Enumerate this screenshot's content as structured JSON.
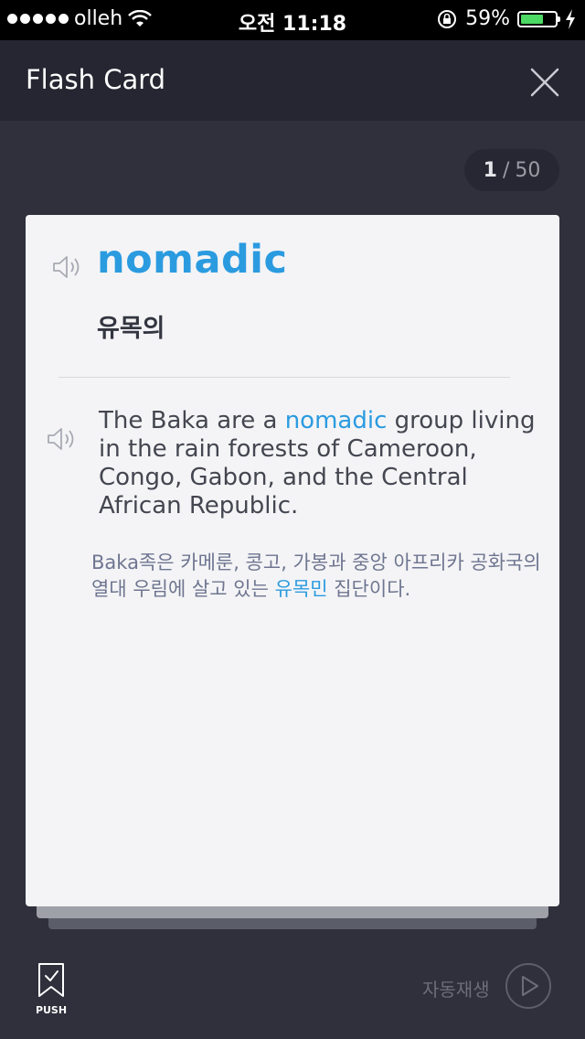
{
  "status_bar": {
    "carrier": "olleh",
    "time": "오전 11:18",
    "battery_percent": "59%",
    "battery_level": 0.59,
    "icons": [
      "signal-dots",
      "wifi-icon",
      "rotation-lock-icon",
      "battery-icon",
      "charging-bolt-icon"
    ]
  },
  "header": {
    "title": "Flash Card",
    "close_icon": "close-icon"
  },
  "counter": {
    "current": "1",
    "separator": "/",
    "total": "50"
  },
  "card": {
    "word": "nomadic",
    "meaning": "유목의",
    "example": {
      "before": "The Baka are a ",
      "highlight": "nomadic",
      "after": " group living in the rain forests of Cameroon, Congo, Gabon, and the Central African Republic."
    },
    "translation": {
      "before": "Baka족은 카메룬, 콩고, 가봉과 중앙 아프리카 공화국의 열대 우림에 살고 있는 ",
      "highlight": "유목민",
      "after": " 집단이다."
    }
  },
  "footer": {
    "push_label": "PUSH",
    "autoplay_label": "자동재생"
  },
  "colors": {
    "accent": "#2b9be0",
    "background": "#2f303c",
    "header": "#252631",
    "card": "#f4f4f6"
  }
}
